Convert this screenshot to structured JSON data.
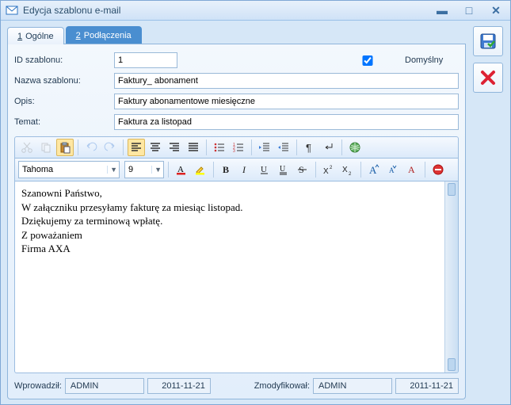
{
  "window": {
    "title": "Edycja szablonu e-mail"
  },
  "side": {
    "save": "save",
    "cancel": "cancel"
  },
  "tabs": [
    {
      "key": "1",
      "label": "Ogólne",
      "active": true
    },
    {
      "key": "2",
      "label": "Podłączenia",
      "active": false
    }
  ],
  "form": {
    "id_label": "ID szablonu:",
    "id_value": "1",
    "default_label": "Domyślny",
    "default_checked": true,
    "name_label": "Nazwa szablonu:",
    "name_value": "Faktury_ abonament",
    "desc_label": "Opis:",
    "desc_value": "Faktury abonamentowe miesięczne",
    "subject_label": "Temat:",
    "subject_value": "Faktura za listopad"
  },
  "editor": {
    "font": "Tahoma",
    "size": "9",
    "body": "Szanowni Państwo,\nW załączniku przesyłamy fakturę za miesiąc listopad.\nDziękujemy za terminową wpłatę.\nZ poważaniem\nFirma AXA"
  },
  "status": {
    "created_label": "Wprowadził:",
    "created_user": "ADMIN",
    "created_date": "2011-11-21",
    "modified_label": "Zmodyfikował:",
    "modified_user": "ADMIN",
    "modified_date": "2011-11-21"
  }
}
